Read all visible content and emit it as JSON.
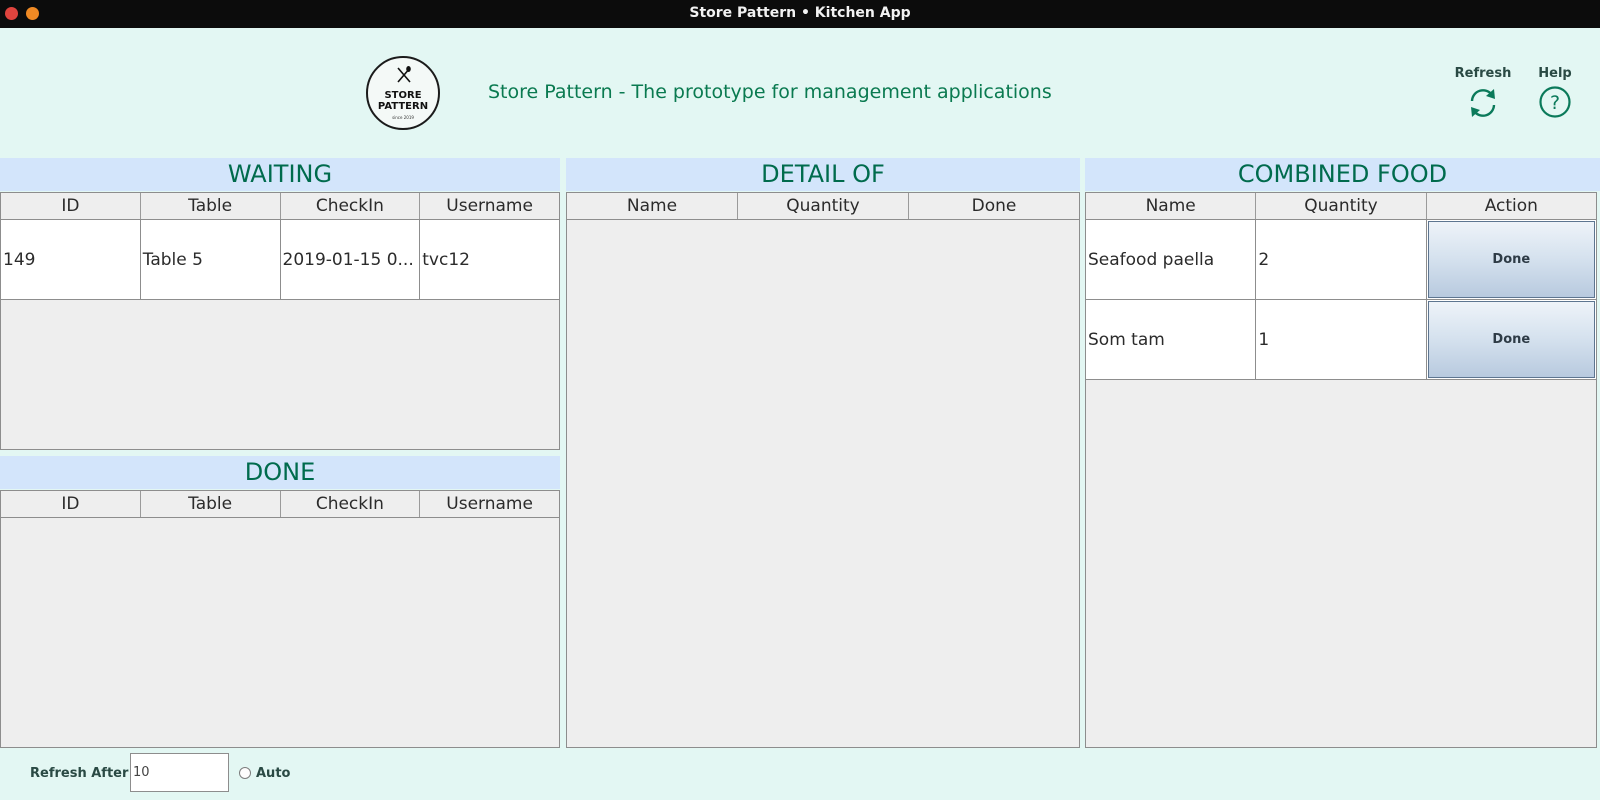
{
  "window": {
    "title": "Store Pattern • Kitchen App"
  },
  "logo": {
    "line1": "STORE",
    "line2": "PATTERN",
    "since": "since 2019"
  },
  "header": {
    "headline": "Store Pattern - The prototype for management applications",
    "refresh_label": "Refresh",
    "help_label": "Help",
    "refresh_icon": "refresh-icon",
    "help_icon": "help-icon"
  },
  "waiting": {
    "title": "WAITING",
    "columns": [
      "ID",
      "Table",
      "CheckIn",
      "Username"
    ],
    "rows": [
      {
        "id": "149",
        "table": "Table 5",
        "checkin": "2019-01-15 0...",
        "username": "tvc12"
      }
    ]
  },
  "done": {
    "title": "DONE",
    "columns": [
      "ID",
      "Table",
      "CheckIn",
      "Username"
    ],
    "rows": []
  },
  "detail": {
    "title": "DETAIL OF",
    "columns": [
      "Name",
      "Quantity",
      "Done"
    ],
    "rows": []
  },
  "combined": {
    "title": "COMBINED FOOD",
    "columns": [
      "Name",
      "Quantity",
      "Action"
    ],
    "rows": [
      {
        "name": "Seafood paella",
        "quantity": "2",
        "action": "Done"
      },
      {
        "name": "Som tam",
        "quantity": "1",
        "action": "Done"
      }
    ]
  },
  "footer": {
    "refresh_after_label": "Refresh After",
    "refresh_after_value": "10",
    "auto_label": "Auto"
  },
  "colors": {
    "title_green": "#006b4d",
    "panel_header_blue": "#d3e5fb",
    "background": "#e3f7f3"
  }
}
